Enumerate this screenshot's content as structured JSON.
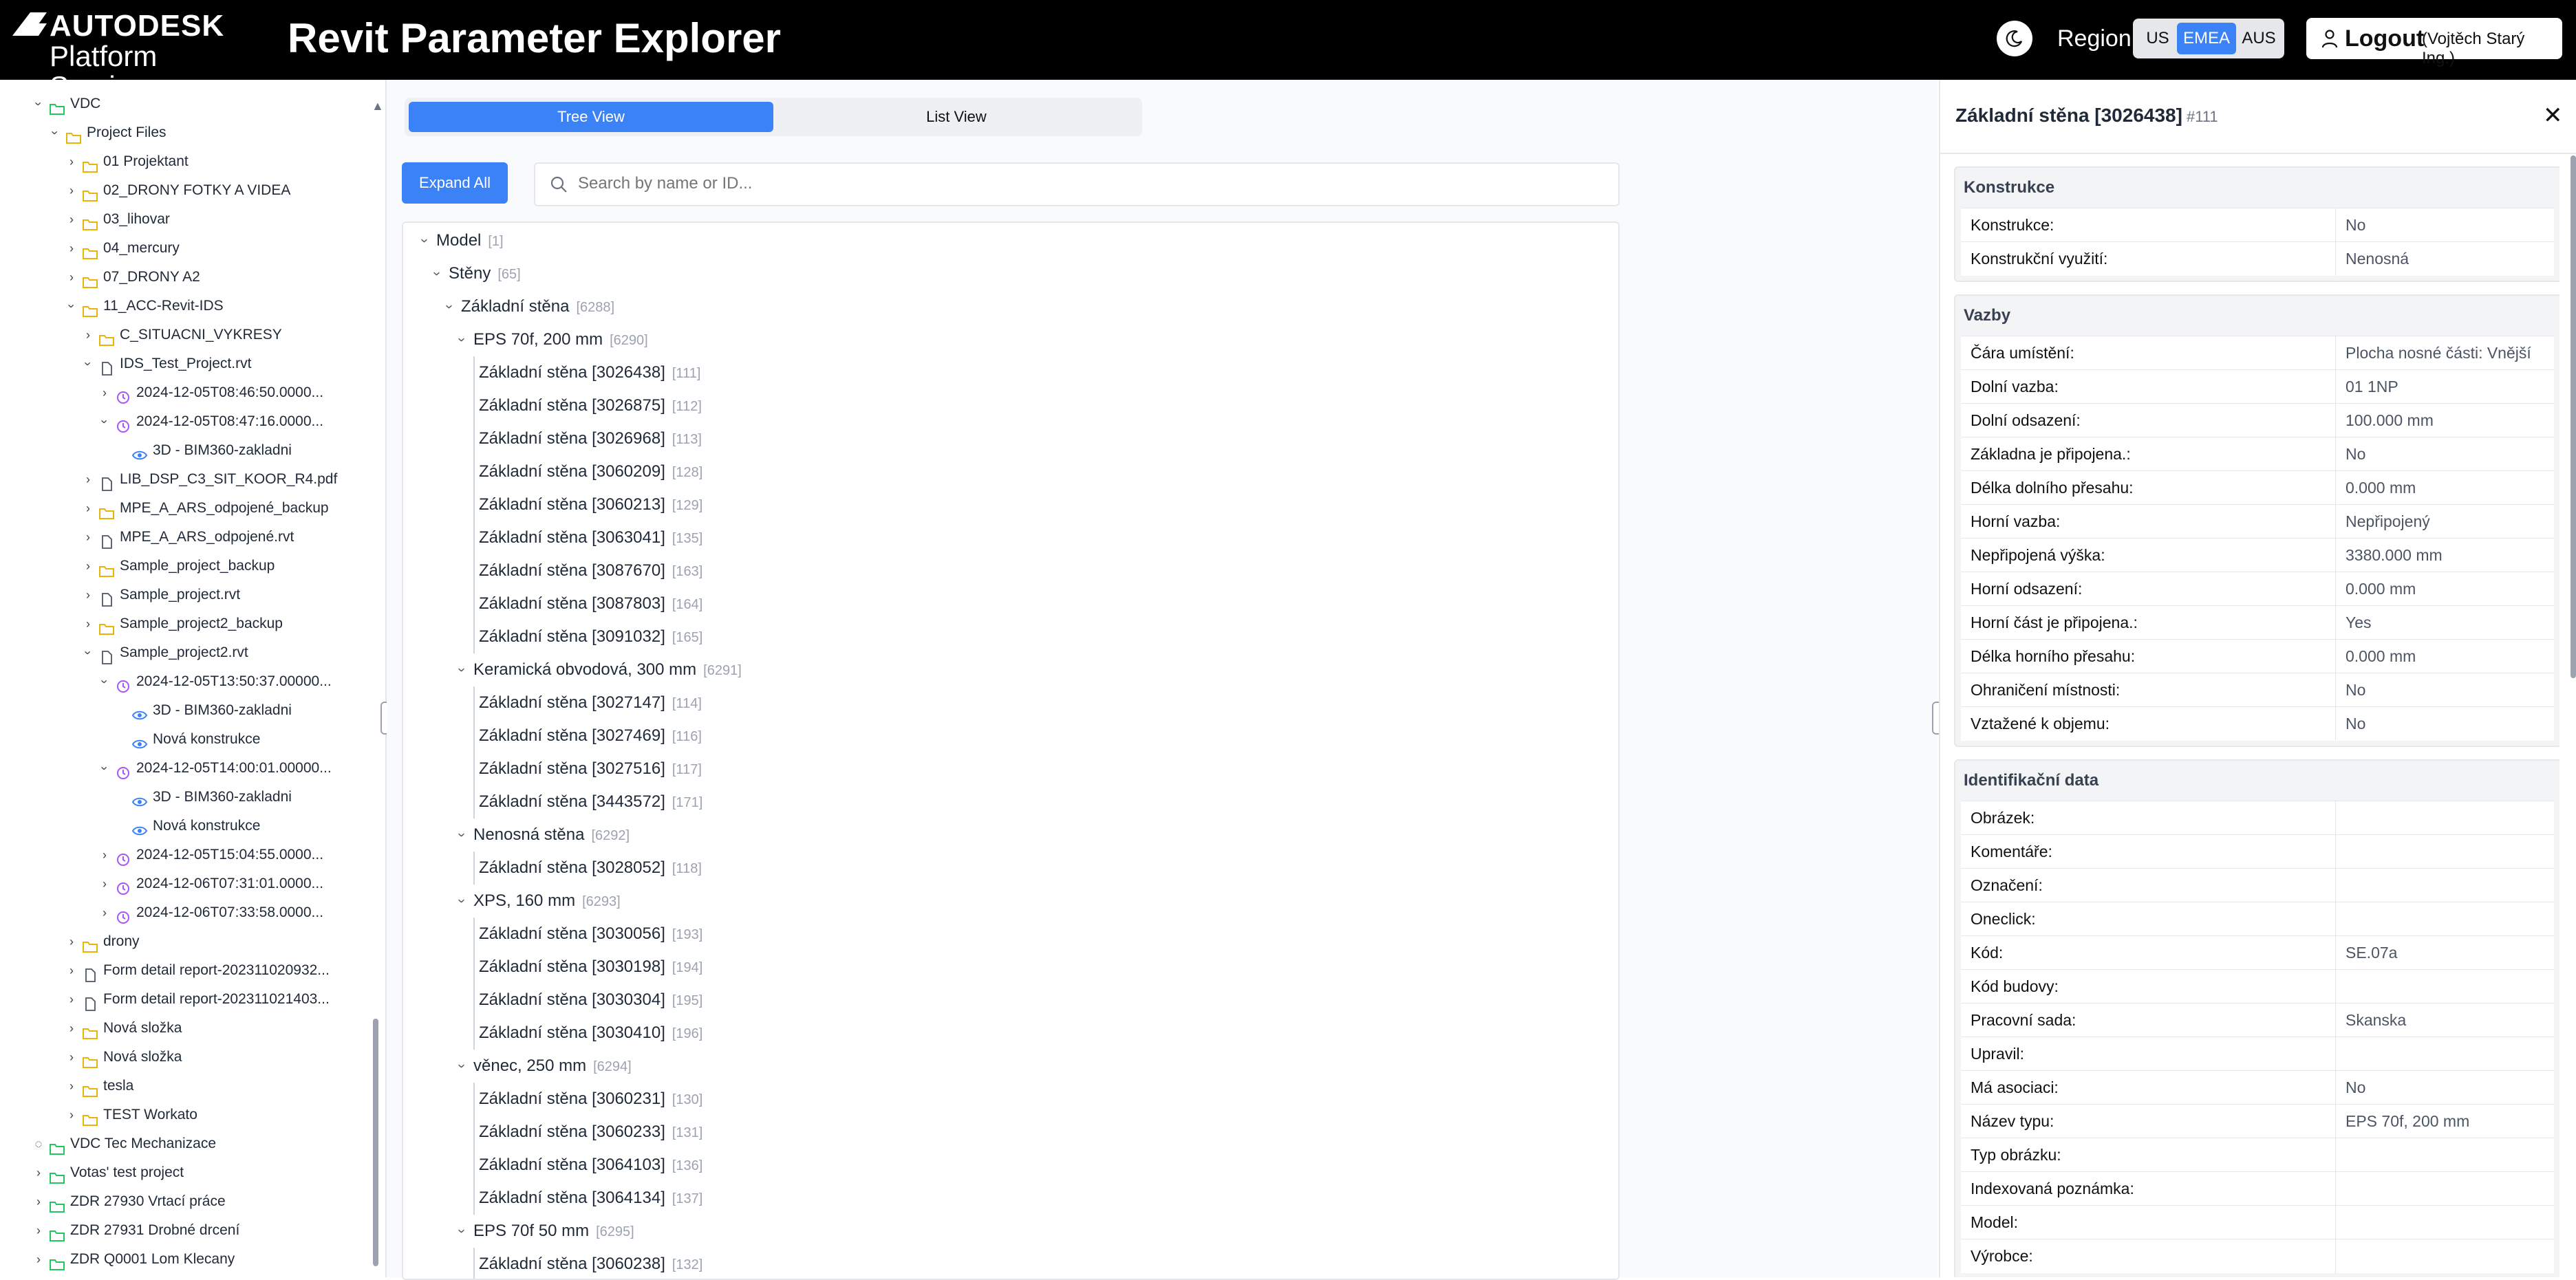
{
  "header": {
    "logo_top": "AUTODESK",
    "logo_bottom": "Platform Services",
    "app_title": "Revit Parameter Explorer",
    "theme_icon": "moon-icon",
    "region_label": "Region:",
    "regions": [
      "US",
      "EMEA",
      "AUS"
    ],
    "selected_region": "EMEA",
    "logout_label": "Logout",
    "logout_user": "(Vojtěch Starý Ing.)"
  },
  "sidebar": {
    "items": [
      {
        "label": "VDC",
        "icon": "folder-green",
        "state": "open"
      },
      {
        "label": "Project Files",
        "icon": "folder-yellow",
        "state": "open"
      },
      {
        "label": "01 Projektant",
        "icon": "folder-yellow",
        "state": "closed"
      },
      {
        "label": "02_DRONY FOTKY A VIDEA",
        "icon": "folder-yellow",
        "state": "closed"
      },
      {
        "label": "03_lihovar",
        "icon": "folder-yellow",
        "state": "closed"
      },
      {
        "label": "04_mercury",
        "icon": "folder-yellow",
        "state": "closed"
      },
      {
        "label": "07_DRONY A2",
        "icon": "folder-yellow",
        "state": "closed"
      },
      {
        "label": "11_ACC-Revit-IDS",
        "icon": "folder-yellow",
        "state": "open"
      },
      {
        "label": "C_SITUACNI_VYKRESY",
        "icon": "folder-yellow",
        "state": "closed"
      },
      {
        "label": "IDS_Test_Project.rvt",
        "icon": "file",
        "state": "open"
      },
      {
        "label": "2024-12-05T08:46:50.0000...",
        "icon": "clock",
        "state": "closed"
      },
      {
        "label": "2024-12-05T08:47:16.0000...",
        "icon": "clock",
        "state": "open"
      },
      {
        "label": "3D - BIM360-zakladni",
        "icon": "eye",
        "state": "none"
      },
      {
        "label": "LIB_DSP_C3_SIT_KOOR_R4.pdf",
        "icon": "file",
        "state": "closed"
      },
      {
        "label": "MPE_A_ARS_odpojené_backup",
        "icon": "folder-yellow",
        "state": "closed"
      },
      {
        "label": "MPE_A_ARS_odpojené.rvt",
        "icon": "file",
        "state": "closed"
      },
      {
        "label": "Sample_project_backup",
        "icon": "folder-yellow",
        "state": "closed"
      },
      {
        "label": "Sample_project.rvt",
        "icon": "file",
        "state": "closed"
      },
      {
        "label": "Sample_project2_backup",
        "icon": "folder-yellow",
        "state": "closed"
      },
      {
        "label": "Sample_project2.rvt",
        "icon": "file",
        "state": "open"
      },
      {
        "label": "2024-12-05T13:50:37.00000...",
        "icon": "clock",
        "state": "open"
      },
      {
        "label": "3D - BIM360-zakladni",
        "icon": "eye",
        "state": "none"
      },
      {
        "label": "Nová konstrukce",
        "icon": "eye",
        "state": "none"
      },
      {
        "label": "2024-12-05T14:00:01.00000...",
        "icon": "clock",
        "state": "open"
      },
      {
        "label": "3D - BIM360-zakladni",
        "icon": "eye",
        "state": "none"
      },
      {
        "label": "Nová konstrukce",
        "icon": "eye",
        "state": "none"
      },
      {
        "label": "2024-12-05T15:04:55.0000...",
        "icon": "clock",
        "state": "closed"
      },
      {
        "label": "2024-12-06T07:31:01.0000...",
        "icon": "clock",
        "state": "closed"
      },
      {
        "label": "2024-12-06T07:33:58.0000...",
        "icon": "clock",
        "state": "closed"
      },
      {
        "label": "drony",
        "icon": "folder-yellow",
        "state": "closed"
      },
      {
        "label": "Form detail report-202311020932...",
        "icon": "file",
        "state": "closed"
      },
      {
        "label": "Form detail report-202311021403...",
        "icon": "file",
        "state": "closed"
      },
      {
        "label": "Nová složka",
        "icon": "folder-yellow",
        "state": "closed"
      },
      {
        "label": "Nová složka",
        "icon": "folder-yellow",
        "state": "closed"
      },
      {
        "label": "tesla",
        "icon": "folder-yellow",
        "state": "closed"
      },
      {
        "label": "TEST Workato",
        "icon": "folder-yellow",
        "state": "closed"
      },
      {
        "label": "VDC Tec Mechanizace",
        "icon": "folder-green",
        "state": "loading"
      },
      {
        "label": "Votas' test project",
        "icon": "folder-green",
        "state": "closed"
      },
      {
        "label": "ZDR 27930 Vrtací práce",
        "icon": "folder-green",
        "state": "closed"
      },
      {
        "label": "ZDR 27931 Drobné drcení",
        "icon": "folder-green",
        "state": "closed"
      },
      {
        "label": "ZDR Q0001 Lom Klecany",
        "icon": "folder-green",
        "state": "closed"
      }
    ]
  },
  "main": {
    "tabs": [
      "Tree View",
      "List View"
    ],
    "active_tab": "Tree View",
    "expand_all_label": "Expand All",
    "search_placeholder": "Search by name or ID...",
    "tree": [
      {
        "label": "Model",
        "id": "[1]",
        "kind": "group"
      },
      {
        "label": "Stěny",
        "id": "[65]",
        "kind": "group"
      },
      {
        "label": "Základní stěna",
        "id": "[6288]",
        "kind": "group"
      },
      {
        "label": "EPS 70f, 200 mm",
        "id": "[6290]",
        "kind": "group"
      },
      {
        "label": "Základní stěna [3026438]",
        "id": "[111]",
        "kind": "leaf"
      },
      {
        "label": "Základní stěna [3026875]",
        "id": "[112]",
        "kind": "leaf"
      },
      {
        "label": "Základní stěna [3026968]",
        "id": "[113]",
        "kind": "leaf"
      },
      {
        "label": "Základní stěna [3060209]",
        "id": "[128]",
        "kind": "leaf"
      },
      {
        "label": "Základní stěna [3060213]",
        "id": "[129]",
        "kind": "leaf"
      },
      {
        "label": "Základní stěna [3063041]",
        "id": "[135]",
        "kind": "leaf"
      },
      {
        "label": "Základní stěna [3087670]",
        "id": "[163]",
        "kind": "leaf"
      },
      {
        "label": "Základní stěna [3087803]",
        "id": "[164]",
        "kind": "leaf"
      },
      {
        "label": "Základní stěna [3091032]",
        "id": "[165]",
        "kind": "leaf"
      },
      {
        "label": "Keramická obvodová, 300 mm",
        "id": "[6291]",
        "kind": "group"
      },
      {
        "label": "Základní stěna [3027147]",
        "id": "[114]",
        "kind": "leaf"
      },
      {
        "label": "Základní stěna [3027469]",
        "id": "[116]",
        "kind": "leaf"
      },
      {
        "label": "Základní stěna [3027516]",
        "id": "[117]",
        "kind": "leaf"
      },
      {
        "label": "Základní stěna [3443572]",
        "id": "[171]",
        "kind": "leaf"
      },
      {
        "label": "Nenosná stěna",
        "id": "[6292]",
        "kind": "group"
      },
      {
        "label": "Základní stěna [3028052]",
        "id": "[118]",
        "kind": "leaf"
      },
      {
        "label": "XPS, 160 mm",
        "id": "[6293]",
        "kind": "group"
      },
      {
        "label": "Základní stěna [3030056]",
        "id": "[193]",
        "kind": "leaf"
      },
      {
        "label": "Základní stěna [3030198]",
        "id": "[194]",
        "kind": "leaf"
      },
      {
        "label": "Základní stěna [3030304]",
        "id": "[195]",
        "kind": "leaf"
      },
      {
        "label": "Základní stěna [3030410]",
        "id": "[196]",
        "kind": "leaf"
      },
      {
        "label": "věnec, 250 mm",
        "id": "[6294]",
        "kind": "group"
      },
      {
        "label": "Základní stěna [3060231]",
        "id": "[130]",
        "kind": "leaf"
      },
      {
        "label": "Základní stěna [3060233]",
        "id": "[131]",
        "kind": "leaf"
      },
      {
        "label": "Základní stěna [3064103]",
        "id": "[136]",
        "kind": "leaf"
      },
      {
        "label": "Základní stěna [3064134]",
        "id": "[137]",
        "kind": "leaf"
      },
      {
        "label": "EPS 70f 50 mm",
        "id": "[6295]",
        "kind": "group"
      },
      {
        "label": "Základní stěna [3060238]",
        "id": "[132]",
        "kind": "leaf"
      }
    ]
  },
  "details": {
    "title": "Základní stěna [3026438]",
    "element_id": "#111",
    "sections": [
      {
        "title": "Konstrukce",
        "rows": [
          {
            "key": "Konstrukce:",
            "value": "No"
          },
          {
            "key": "Konstrukční využití:",
            "value": "Nenosná"
          }
        ]
      },
      {
        "title": "Vazby",
        "rows": [
          {
            "key": "Čára umístění:",
            "value": "Plocha nosné části: Vnější"
          },
          {
            "key": "Dolní vazba:",
            "value": "01 1NP"
          },
          {
            "key": "Dolní odsazení:",
            "value": "100.000 mm"
          },
          {
            "key": "Základna je připojena.:",
            "value": "No"
          },
          {
            "key": "Délka dolního přesahu:",
            "value": "0.000 mm"
          },
          {
            "key": "Horní vazba:",
            "value": "Nepřipojený"
          },
          {
            "key": "Nepřipojená výška:",
            "value": "3380.000 mm"
          },
          {
            "key": "Horní odsazení:",
            "value": "0.000 mm"
          },
          {
            "key": "Horní část je připojena.:",
            "value": "Yes"
          },
          {
            "key": "Délka horního přesahu:",
            "value": "0.000 mm"
          },
          {
            "key": "Ohraničení místnosti:",
            "value": "No"
          },
          {
            "key": "Vztažené k objemu:",
            "value": "No"
          }
        ]
      },
      {
        "title": "Identifikační data",
        "rows": [
          {
            "key": "Obrázek:",
            "value": ""
          },
          {
            "key": "Komentáře:",
            "value": ""
          },
          {
            "key": "Označení:",
            "value": ""
          },
          {
            "key": "Oneclick:",
            "value": ""
          },
          {
            "key": "Kód:",
            "value": "SE.07a"
          },
          {
            "key": "Kód budovy:",
            "value": ""
          },
          {
            "key": "Pracovní sada:",
            "value": "Skanska"
          },
          {
            "key": "Upravil:",
            "value": ""
          },
          {
            "key": "Má asociaci:",
            "value": "No"
          },
          {
            "key": "Název typu:",
            "value": "EPS 70f, 200 mm"
          },
          {
            "key": "Typ obrázku:",
            "value": ""
          },
          {
            "key": "Indexovaná poznámka:",
            "value": ""
          },
          {
            "key": "Model:",
            "value": ""
          },
          {
            "key": "Výrobce:",
            "value": ""
          }
        ]
      }
    ]
  },
  "colors": {
    "accent": "#3b82f6",
    "header_bg": "#000000",
    "folder_green": "#22c55e",
    "folder_yellow": "#eab308",
    "clock_purple": "#a855f7",
    "eye_blue": "#3b82f6"
  }
}
